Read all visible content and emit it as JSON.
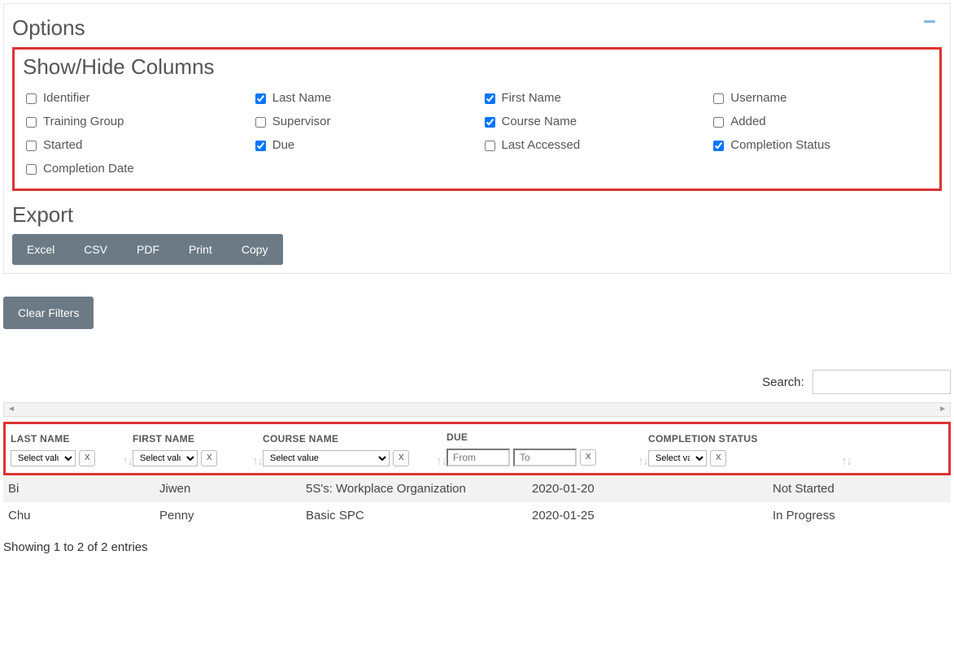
{
  "options": {
    "heading": "Options",
    "showhide_heading": "Show/Hide Columns",
    "columns": [
      {
        "label": "Identifier",
        "checked": false
      },
      {
        "label": "Last Name",
        "checked": true
      },
      {
        "label": "First Name",
        "checked": true
      },
      {
        "label": "Username",
        "checked": false
      },
      {
        "label": "Training Group",
        "checked": false
      },
      {
        "label": "Supervisor",
        "checked": false
      },
      {
        "label": "Course Name",
        "checked": true
      },
      {
        "label": "Added",
        "checked": false
      },
      {
        "label": "Started",
        "checked": false
      },
      {
        "label": "Due",
        "checked": true
      },
      {
        "label": "Last Accessed",
        "checked": false
      },
      {
        "label": "Completion Status",
        "checked": true
      },
      {
        "label": "Completion Date",
        "checked": false
      }
    ],
    "export_heading": "Export",
    "export_buttons": [
      "Excel",
      "CSV",
      "PDF",
      "Print",
      "Copy"
    ]
  },
  "clear_filters_label": "Clear Filters",
  "search_label": "Search:",
  "table": {
    "headers": {
      "last_name": "LAST NAME",
      "first_name": "FIRST NAME",
      "course_name": "COURSE NAME",
      "due": "DUE",
      "completion_status": "COMPLETION STATUS"
    },
    "filter_placeholder": "Select value",
    "from_placeholder": "From",
    "to_placeholder": "To",
    "clear_x": "X",
    "rows": [
      {
        "last_name": "Bi",
        "first_name": "Jiwen",
        "course_name": "5S's: Workplace Organization",
        "due": "2020-01-20",
        "completion_status": "Not Started"
      },
      {
        "last_name": "Chu",
        "first_name": "Penny",
        "course_name": "Basic SPC",
        "due": "2020-01-25",
        "completion_status": "In Progress"
      }
    ],
    "entries_text": "Showing 1 to 2 of 2 entries"
  }
}
